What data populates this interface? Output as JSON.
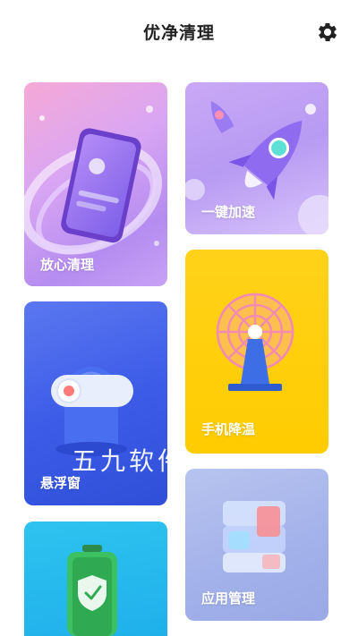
{
  "header": {
    "title": "优净清理",
    "settings_icon": "gear-icon"
  },
  "cards": {
    "clean": {
      "label": "放心清理"
    },
    "speed": {
      "label": "一键加速"
    },
    "cool": {
      "label": "手机降温"
    },
    "float": {
      "label": "悬浮窗"
    },
    "app": {
      "label": "应用管理"
    },
    "battery": {
      "label": ""
    }
  },
  "watermark": "五九软件",
  "colors": {
    "cool_card": "#ffcc00",
    "float_card": "#3d5ce8",
    "battery_card": "#1fb0ea"
  }
}
